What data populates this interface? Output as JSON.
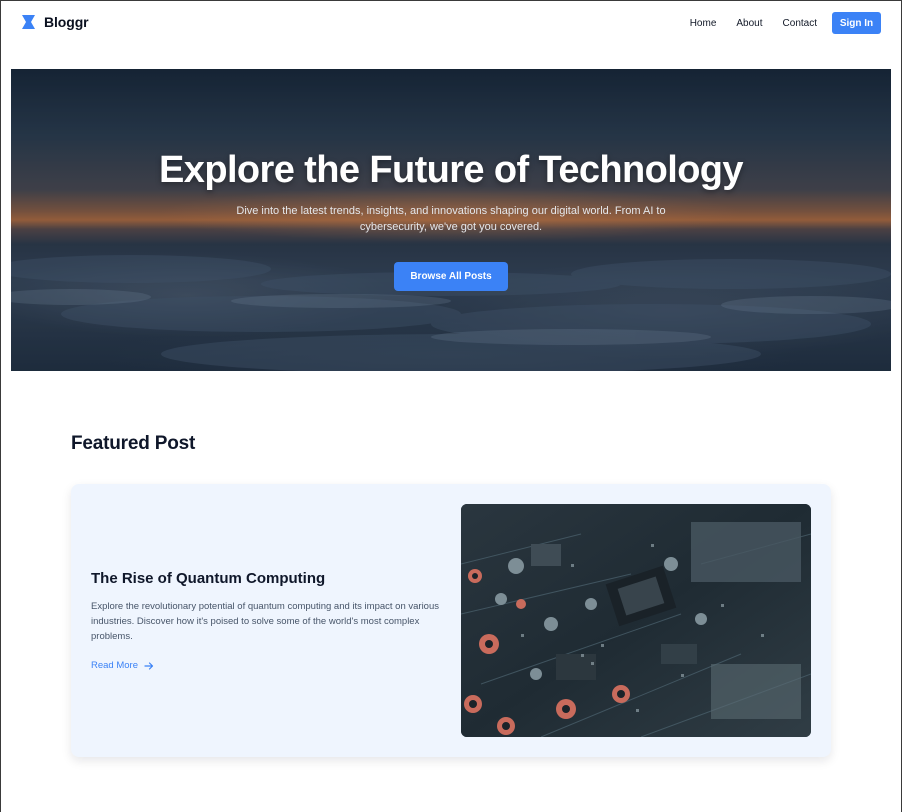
{
  "brand": {
    "name": "Bloggr",
    "icon": "bookmark-icon",
    "color": "#3b82f6"
  },
  "nav": {
    "items": [
      "Home",
      "About",
      "Contact"
    ],
    "signin_label": "Sign In"
  },
  "hero": {
    "title": "Explore the Future of Technology",
    "subtitle": "Dive into the latest trends, insights, and innovations shaping our digital world. From AI to cybersecurity, we've got you covered.",
    "button_label": "Browse All Posts"
  },
  "featured": {
    "section_title": "Featured Post",
    "post": {
      "title": "The Rise of Quantum Computing",
      "excerpt": "Explore the revolutionary potential of quantum computing and its impact on various industries. Discover how it's poised to solve some of the world's most complex problems.",
      "read_more_label": "Read More",
      "image": "circuit-board-photo"
    }
  },
  "colors": {
    "accent": "#3b82f6",
    "card_bg": "#eff5fe",
    "text_dark": "#0f172a"
  }
}
